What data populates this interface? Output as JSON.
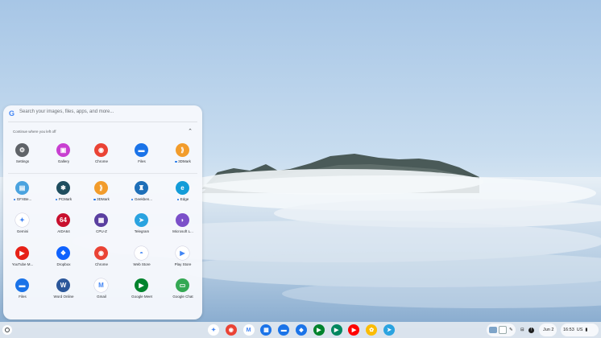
{
  "launcher": {
    "search_placeholder": "Search your images, files, apps, and more...",
    "continue_label": "Continue where you left off",
    "apps": [
      {
        "label": "Settings",
        "icon": "gear-icon",
        "color": "#5f6368",
        "glyph": "⚙",
        "dot": false
      },
      {
        "label": "Gallery",
        "icon": "gallery-icon",
        "color": "#c83fd1",
        "glyph": "▣",
        "dot": false
      },
      {
        "label": "Chrome",
        "icon": "chrome-icon",
        "color": "#ea4335",
        "glyph": "◉",
        "dot": false
      },
      {
        "label": "Files",
        "icon": "folder-icon",
        "color": "#1a73e8",
        "glyph": "▬",
        "dot": false
      },
      {
        "label": "3DMark",
        "icon": "3dmark-icon",
        "color": "#f29c2b",
        "glyph": "⟫",
        "dot": true
      },
      {
        "label": "GFXBe...",
        "icon": "gfxbench-icon",
        "color": "#4aa3df",
        "glyph": "▤",
        "dot": true
      },
      {
        "label": "PCMark",
        "icon": "pcmark-icon",
        "color": "#1f4e5f",
        "glyph": "✱",
        "dot": true
      },
      {
        "label": "3DMark",
        "icon": "3dmark-icon",
        "color": "#f29c2b",
        "glyph": "⟫",
        "dot": true
      },
      {
        "label": "Geekben...",
        "icon": "geekbench-icon",
        "color": "#1e6fb8",
        "glyph": "♜",
        "dot": true
      },
      {
        "label": "Edge",
        "icon": "edge-icon",
        "color": "#139cd8",
        "glyph": "e",
        "dot": true
      },
      {
        "label": "Gemini",
        "icon": "gemini-icon",
        "color": "#ffffff",
        "glyph": "✦",
        "dot": false
      },
      {
        "label": "AIDA64",
        "icon": "aida64-icon",
        "color": "#c8102e",
        "glyph": "64",
        "dot": false
      },
      {
        "label": "CPU-Z",
        "icon": "cpuz-icon",
        "color": "#5a3fa0",
        "glyph": "▦",
        "dot": false
      },
      {
        "label": "Telegram",
        "icon": "telegram-icon",
        "color": "#2aa3e0",
        "glyph": "➤",
        "dot": false
      },
      {
        "label": "Microsoft L...",
        "icon": "microsoft-launcher-icon",
        "color": "#7b4fc9",
        "glyph": "◗",
        "dot": false
      },
      {
        "label": "YouTube M...",
        "icon": "youtube-music-icon",
        "color": "#e62117",
        "glyph": "▶",
        "dot": false
      },
      {
        "label": "Dropbox",
        "icon": "dropbox-icon",
        "color": "#0f62fe",
        "glyph": "❖",
        "dot": false
      },
      {
        "label": "Chrome",
        "icon": "chrome-icon",
        "color": "#ea4335",
        "glyph": "◉",
        "dot": false
      },
      {
        "label": "Web Store",
        "icon": "web-store-icon",
        "color": "#ffffff",
        "glyph": "◓",
        "dot": false
      },
      {
        "label": "Play Store",
        "icon": "play-store-icon",
        "color": "#ffffff",
        "glyph": "▶",
        "dot": false
      },
      {
        "label": "Files",
        "icon": "folder-icon",
        "color": "#1a73e8",
        "glyph": "▬",
        "dot": false
      },
      {
        "label": "Word Online",
        "icon": "word-icon",
        "color": "#2b579a",
        "glyph": "W",
        "dot": false
      },
      {
        "label": "Gmail",
        "icon": "gmail-icon",
        "color": "#ffffff",
        "glyph": "M",
        "dot": false
      },
      {
        "label": "Google Meet",
        "icon": "google-meet-icon",
        "color": "#00832d",
        "glyph": "▶",
        "dot": false
      },
      {
        "label": "Google Chat",
        "icon": "google-chat-icon",
        "color": "#34a853",
        "glyph": "▭",
        "dot": false
      }
    ]
  },
  "shelf": {
    "pinned": [
      {
        "icon": "gemini-icon",
        "color": "#ffffff",
        "glyph": "✦"
      },
      {
        "icon": "chrome-icon",
        "color": "#ea4335",
        "glyph": "◉"
      },
      {
        "icon": "gmail-icon",
        "color": "#ffffff",
        "glyph": "M"
      },
      {
        "icon": "calendar-icon",
        "color": "#1a73e8",
        "glyph": "▦"
      },
      {
        "icon": "files-icon",
        "color": "#1a73e8",
        "glyph": "▬"
      },
      {
        "icon": "messages-icon",
        "color": "#1a73e8",
        "glyph": "◆"
      },
      {
        "icon": "meet-icon",
        "color": "#00832d",
        "glyph": "▶"
      },
      {
        "icon": "play-store-icon",
        "color": "#01875f",
        "glyph": "▶"
      },
      {
        "icon": "youtube-icon",
        "color": "#ff0000",
        "glyph": "▶"
      },
      {
        "icon": "photos-icon",
        "color": "#fbbc04",
        "glyph": "✿"
      },
      {
        "icon": "telegram-icon",
        "color": "#2aa3e0",
        "glyph": "➤"
      }
    ],
    "date": "Jun 2",
    "time": "16:53",
    "locale": "US"
  }
}
